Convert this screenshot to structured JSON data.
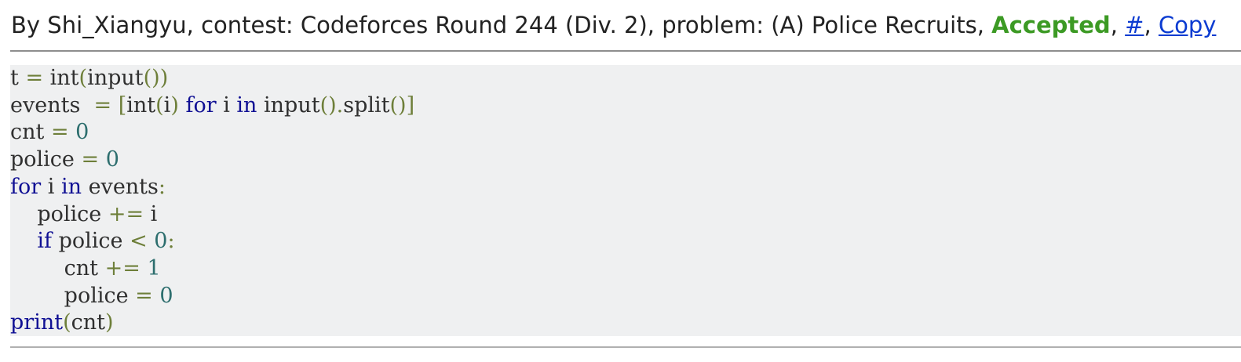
{
  "submission": {
    "prefix": "By ",
    "author": "Shi_Xiangyu",
    "contest_prefix": ", contest: ",
    "contest": "Codeforces Round 244 (Div. 2)",
    "problem_prefix": ", problem: ",
    "problem": "(A) Police Recruits",
    "sep1": ", ",
    "verdict": "Accepted",
    "sep2": ", ",
    "permalink_label": "#",
    "sep3": ", ",
    "copy_label": "Copy"
  },
  "colors": {
    "verdict": "#3c9a24",
    "link": "#0b3bd1",
    "keyword": "#101094",
    "number": "#2d6e6e",
    "operator": "#6e7f3a",
    "code_background": "#eff0f1"
  },
  "code": {
    "language": "python",
    "lines": [
      [
        [
          "name",
          "t "
        ],
        [
          "op",
          "="
        ],
        [
          "name",
          " int"
        ],
        [
          "op",
          "("
        ],
        [
          "name",
          "input"
        ],
        [
          "op",
          "())"
        ]
      ],
      [
        [
          "name",
          "events  "
        ],
        [
          "op",
          "="
        ],
        [
          "name",
          " "
        ],
        [
          "op",
          "["
        ],
        [
          "name",
          "int"
        ],
        [
          "op",
          "("
        ],
        [
          "name",
          "i"
        ],
        [
          "op",
          ")"
        ],
        [
          "name",
          " "
        ],
        [
          "kw",
          "for"
        ],
        [
          "name",
          " i "
        ],
        [
          "kw",
          "in"
        ],
        [
          "name",
          " input"
        ],
        [
          "op",
          "()."
        ],
        [
          "name",
          "split"
        ],
        [
          "op",
          "()]"
        ]
      ],
      [
        [
          "name",
          "cnt "
        ],
        [
          "op",
          "="
        ],
        [
          "name",
          " "
        ],
        [
          "num",
          "0"
        ]
      ],
      [
        [
          "name",
          "police "
        ],
        [
          "op",
          "="
        ],
        [
          "name",
          " "
        ],
        [
          "num",
          "0"
        ]
      ],
      [
        [
          "kw",
          "for"
        ],
        [
          "name",
          " i "
        ],
        [
          "kw",
          "in"
        ],
        [
          "name",
          " events"
        ],
        [
          "op",
          ":"
        ]
      ],
      [
        [
          "name",
          "    police "
        ],
        [
          "op",
          "+="
        ],
        [
          "name",
          " i"
        ]
      ],
      [
        [
          "name",
          "    "
        ],
        [
          "kw",
          "if"
        ],
        [
          "name",
          " police "
        ],
        [
          "op",
          "<"
        ],
        [
          "name",
          " "
        ],
        [
          "num",
          "0"
        ],
        [
          "op",
          ":"
        ]
      ],
      [
        [
          "name",
          "        cnt "
        ],
        [
          "op",
          "+="
        ],
        [
          "name",
          " "
        ],
        [
          "num",
          "1"
        ]
      ],
      [
        [
          "name",
          "        police "
        ],
        [
          "op",
          "="
        ],
        [
          "name",
          " "
        ],
        [
          "num",
          "0"
        ]
      ],
      [
        [
          "kw",
          "print"
        ],
        [
          "op",
          "("
        ],
        [
          "name",
          "cnt"
        ],
        [
          "op",
          ")"
        ]
      ]
    ]
  }
}
